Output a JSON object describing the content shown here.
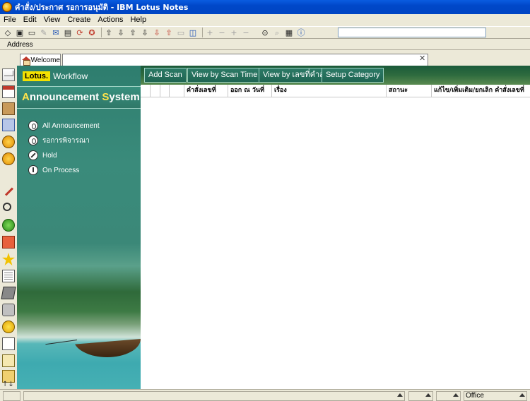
{
  "window": {
    "title": "คำสั่ง/ประกาศ รอการอนุมัติ - IBM Lotus Notes"
  },
  "menu": [
    {
      "label": "File"
    },
    {
      "label": "Edit"
    },
    {
      "label": "View"
    },
    {
      "label": "Create"
    },
    {
      "label": "Actions"
    },
    {
      "label": "Help"
    }
  ],
  "toolbar": {
    "icons": [
      "home-icon",
      "save-icon",
      "open-folder-icon",
      "edit-icon",
      "forward-icon",
      "print-icon",
      "replicate-icon",
      "stop-icon",
      "up-icon",
      "down-icon",
      "up-unread-icon",
      "down-unread-icon",
      "mark-read-icon",
      "refresh-icon",
      "toggle-icon",
      "expand-icon",
      "collapse-icon",
      "find-icon",
      "search-icon",
      "properties-icon",
      "info-icon"
    ]
  },
  "address": {
    "label": "Address",
    "value": ""
  },
  "tabs": [
    {
      "label": "Welcome"
    },
    {
      "label": ""
    }
  ],
  "workflow": {
    "brand_logo": "Lotus.",
    "brand_text": "Workflow",
    "system_title": {
      "part1_hl": "A",
      "part1": "nnouncement ",
      "part2_hl": "S",
      "part2": "ystem"
    },
    "nav": [
      {
        "label": "All Announcement",
        "icon": "all-announcement-icon"
      },
      {
        "label": "รอการพิจารณา",
        "icon": "pending-review-icon"
      },
      {
        "label": "Hold",
        "icon": "hold-icon"
      },
      {
        "label": "On Process",
        "icon": "on-process-icon"
      }
    ]
  },
  "actions": [
    {
      "label": "Add Scan"
    },
    {
      "label": "View by Scan Time"
    },
    {
      "label": "View by เลขที่คำสั่ง"
    },
    {
      "label": "Setup Category"
    }
  ],
  "columns": [
    {
      "label": ""
    },
    {
      "label": ""
    },
    {
      "label": ""
    },
    {
      "label": ""
    },
    {
      "label": "คำสั่งเลขที่"
    },
    {
      "label": "ออก ณ วันที่"
    },
    {
      "label": "เรื่อง"
    },
    {
      "label": "สถานะ"
    },
    {
      "label": "แก้ไข/เพิ่มเติม/ยกเลิก คำสั่งเลขที่"
    }
  ],
  "statusbar": {
    "location": "Office"
  }
}
